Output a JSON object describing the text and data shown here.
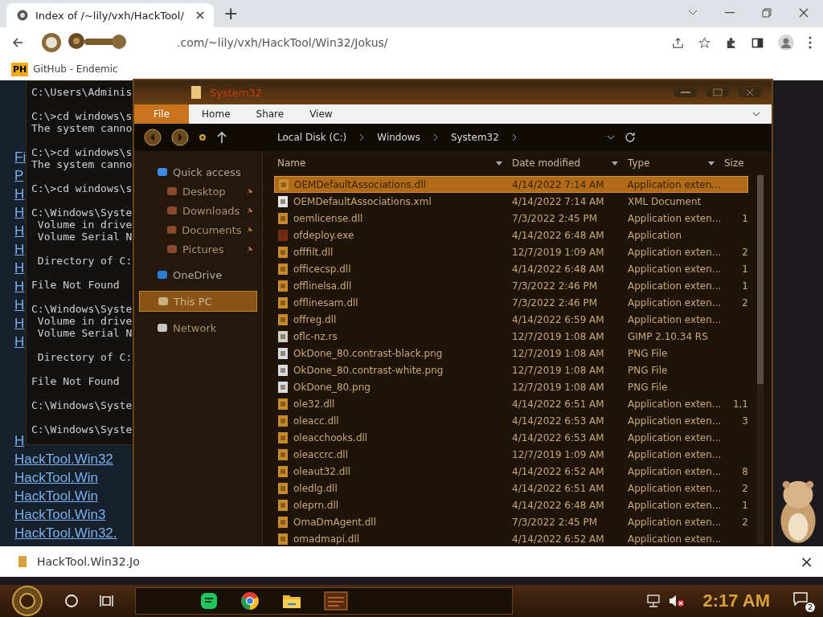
{
  "browser": {
    "tabs": [
      {
        "title": "Index of /~lily/vxh/HackTool/",
        "selected": true
      }
    ],
    "new_tab": "+",
    "url": ".com/~lily/vxh/HackTool/Win32/Jokus/",
    "bookmarks": [
      {
        "badge": "PH",
        "label": "GitHub - Endemic"
      }
    ],
    "page_links_top": [
      "Fi",
      "P",
      "H",
      "H",
      "H",
      "H",
      "H",
      "H",
      "H",
      "H",
      "H"
    ],
    "page_links_bottom": [
      "H",
      "HackTool.Win32",
      "HackTool.Win",
      "HackTool.Win",
      "HackTool.Win3",
      "HackTool.Win32."
    ],
    "download": {
      "file": "HackTool.Win32.Jo",
      "close": "×"
    }
  },
  "terminal": {
    "blocks": [
      [
        "C:\\Users\\Adminis"
      ],
      [
        "C:\\>cd windows\\s",
        "The system canno"
      ],
      [
        "C:\\>cd windows\\s",
        "The system canno"
      ],
      [
        "C:\\>cd windows\\s"
      ],
      [
        "C:\\Windows\\Syste",
        " Volume in drive",
        " Volume Serial N"
      ],
      [
        " Directory of C:"
      ],
      [
        "File Not Found"
      ],
      [
        "C:\\Windows\\Syste",
        " Volume in drive",
        " Volume Serial N"
      ],
      [
        " Directory of C:"
      ],
      [
        "File Not Found"
      ],
      [
        "C:\\Windows\\Syste"
      ],
      [
        "C:\\Windows\\Syste"
      ]
    ]
  },
  "explorer": {
    "title": "System32",
    "ribbon_tabs": [
      {
        "label": "File",
        "selected": true
      },
      {
        "label": "Home",
        "selected": false
      },
      {
        "label": "Share",
        "selected": false
      },
      {
        "label": "View",
        "selected": false
      }
    ],
    "breadcrumb": [
      "Local Disk (C:)",
      "Windows",
      "System32"
    ],
    "nav": [
      {
        "label": "Quick access",
        "kind": "quick",
        "pinned": false,
        "selected": false
      },
      {
        "label": "Desktop",
        "kind": "folder",
        "pinned": true,
        "selected": false
      },
      {
        "label": "Downloads",
        "kind": "folder",
        "pinned": true,
        "selected": false
      },
      {
        "label": "Documents",
        "kind": "folder",
        "pinned": true,
        "selected": false
      },
      {
        "label": "Pictures",
        "kind": "folder",
        "pinned": true,
        "selected": false
      },
      {
        "label": "OneDrive",
        "kind": "cloud",
        "pinned": false,
        "selected": false
      },
      {
        "label": "This PC",
        "kind": "pc",
        "pinned": false,
        "selected": true
      },
      {
        "label": "Network",
        "kind": "network",
        "pinned": false,
        "selected": false
      }
    ],
    "columns": [
      "Name",
      "Date modified",
      "Type",
      "Size"
    ],
    "rows": [
      {
        "name": "OEMDefaultAssociations.dll",
        "date": "4/14/2022 7:14 AM",
        "type": "Application exten...",
        "size": "",
        "kind": "dll",
        "selected": true
      },
      {
        "name": "OEMDefaultAssociations.xml",
        "date": "4/14/2022 7:14 AM",
        "type": "XML Document",
        "size": "",
        "kind": "xml",
        "selected": false
      },
      {
        "name": "oemlicense.dll",
        "date": "7/3/2022 2:45 PM",
        "type": "Application exten...",
        "size": "1",
        "kind": "dll",
        "selected": false
      },
      {
        "name": "ofdeploy.exe",
        "date": "4/14/2022 6:48 AM",
        "type": "Application",
        "size": "",
        "kind": "exe",
        "selected": false
      },
      {
        "name": "offfilt.dll",
        "date": "12/7/2019 1:09 AM",
        "type": "Application exten...",
        "size": "2",
        "kind": "dll",
        "selected": false
      },
      {
        "name": "officecsp.dll",
        "date": "4/14/2022 6:48 AM",
        "type": "Application exten...",
        "size": "1",
        "kind": "dll",
        "selected": false
      },
      {
        "name": "offlinelsa.dll",
        "date": "7/3/2022 2:46 PM",
        "type": "Application exten...",
        "size": "1",
        "kind": "dll",
        "selected": false
      },
      {
        "name": "offlinesam.dll",
        "date": "7/3/2022 2:46 PM",
        "type": "Application exten...",
        "size": "2",
        "kind": "dll",
        "selected": false
      },
      {
        "name": "offreg.dll",
        "date": "4/14/2022 6:59 AM",
        "type": "Application exten...",
        "size": "",
        "kind": "dll",
        "selected": false
      },
      {
        "name": "oflc-nz.rs",
        "date": "12/7/2019 1:08 AM",
        "type": "GIMP 2.10.34 RS",
        "size": "",
        "kind": "rs",
        "selected": false
      },
      {
        "name": "OkDone_80.contrast-black.png",
        "date": "12/7/2019 1:08 AM",
        "type": "PNG File",
        "size": "",
        "kind": "png",
        "selected": false
      },
      {
        "name": "OkDone_80.contrast-white.png",
        "date": "12/7/2019 1:08 AM",
        "type": "PNG File",
        "size": "",
        "kind": "png",
        "selected": false
      },
      {
        "name": "OkDone_80.png",
        "date": "12/7/2019 1:08 AM",
        "type": "PNG File",
        "size": "",
        "kind": "png",
        "selected": false
      },
      {
        "name": "ole32.dll",
        "date": "4/14/2022 6:51 AM",
        "type": "Application exten...",
        "size": "1,1",
        "kind": "dll",
        "selected": false
      },
      {
        "name": "oleacc.dll",
        "date": "4/14/2022 6:53 AM",
        "type": "Application exten...",
        "size": "3",
        "kind": "dll",
        "selected": false
      },
      {
        "name": "oleacchooks.dll",
        "date": "4/14/2022 6:53 AM",
        "type": "Application exten...",
        "size": "",
        "kind": "dll",
        "selected": false
      },
      {
        "name": "oleaccrc.dll",
        "date": "12/7/2019 1:09 AM",
        "type": "Application exten...",
        "size": "",
        "kind": "dll",
        "selected": false
      },
      {
        "name": "oleaut32.dll",
        "date": "4/14/2022 6:52 AM",
        "type": "Application exten...",
        "size": "8",
        "kind": "dll",
        "selected": false
      },
      {
        "name": "oledlg.dll",
        "date": "4/14/2022 6:51 AM",
        "type": "Application exten...",
        "size": "2",
        "kind": "dll",
        "selected": false
      },
      {
        "name": "oleprn.dll",
        "date": "4/14/2022 6:48 AM",
        "type": "Application exten...",
        "size": "1",
        "kind": "dll",
        "selected": false
      },
      {
        "name": "OmaDmAgent.dll",
        "date": "7/3/2022 2:45 PM",
        "type": "Application exten...",
        "size": "2",
        "kind": "dll",
        "selected": false
      },
      {
        "name": "omadmapi.dll",
        "date": "4/14/2022 6:52 AM",
        "type": "Application exten...",
        "size": "",
        "kind": "dll",
        "selected": false
      }
    ]
  },
  "taskbar": {
    "time": "2:17 AM",
    "notifications": "2",
    "volume_muted": true
  }
}
